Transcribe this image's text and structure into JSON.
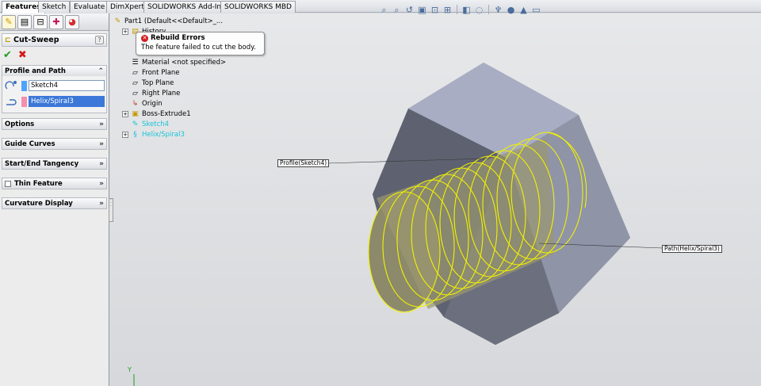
{
  "command_tabs": [
    "Features",
    "Sketch",
    "Evaluate",
    "DimXpert",
    "SOLIDWORKS Add-Ins",
    "SOLIDWORKS MBD"
  ],
  "active_tab": "Features",
  "property_manager": {
    "title": "Cut-Sweep",
    "help": "?",
    "ok_symbol": "✔",
    "cancel_symbol": "✖",
    "groups": {
      "profile_path": {
        "label": "Profile and Path",
        "profile_value": "Sketch4",
        "path_value": "Helix/Spiral3",
        "profile_color": "#4da3ff",
        "path_color": "#f48fb1"
      },
      "options": "Options",
      "guide_curves": "Guide Curves",
      "start_end_tangency": "Start/End Tangency",
      "thin_feature": "Thin Feature",
      "curvature_display": "Curvature Display"
    }
  },
  "feature_tree": {
    "part": "Part1  (Default<<Default>_...",
    "history": "History",
    "material": "Material <not specified>",
    "front_plane": "Front Plane",
    "top_plane": "Top Plane",
    "right_plane": "Right Plane",
    "origin": "Origin",
    "boss_extrude": "Boss-Extrude1",
    "sketch": "Sketch4",
    "helix": "Helix/Spiral3"
  },
  "tooltip": {
    "title": "Rebuild Errors",
    "message": "The feature failed to cut the body."
  },
  "callouts": {
    "profile": "Profile(Sketch4)",
    "path": "Path(Helix/Spiral3)"
  },
  "colors": {
    "helix": "#f2f200",
    "body_face_light": "#a8adc3",
    "body_face_dark": "#5e6270"
  },
  "triad_label": "Y"
}
